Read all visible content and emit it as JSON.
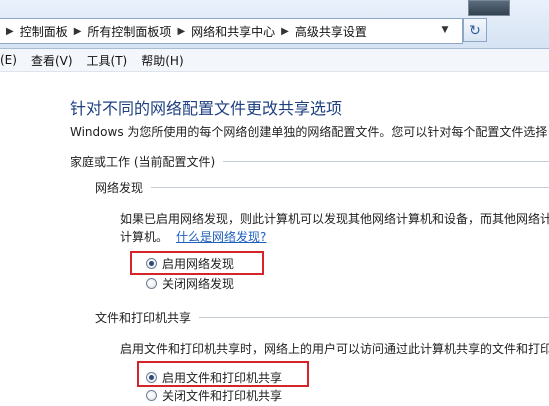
{
  "address_bar": {
    "crumbs": [
      "控制面板",
      "所有控制面板项",
      "网络和共享中心",
      "高级共享设置"
    ]
  },
  "menu": {
    "items": [
      "(E)",
      "查看(V)",
      "工具(T)",
      "帮助(H)"
    ]
  },
  "page": {
    "title": "针对不同的网络配置文件更改共享选项",
    "description": "Windows 为您所使用的每个网络创建单独的网络配置文件。您可以针对每个配置文件选择"
  },
  "profile": {
    "label": "家庭或工作 (当前配置文件)"
  },
  "network_discovery": {
    "label": "网络发现",
    "desc_line1": "如果已启用网络发现，则此计算机可以发现其他网络计算机和设备，而其他网络计",
    "desc_line2": "计算机。",
    "link": "什么是网络发现?",
    "option_on": "启用网络发现",
    "option_off": "关闭网络发现",
    "selected": "on"
  },
  "file_printer_sharing": {
    "label": "文件和打印机共享",
    "desc": "启用文件和打印机共享时，网络上的用户可以访问通过此计算机共享的文件和打印",
    "option_on": "启用文件和打印机共享",
    "option_off": "关闭文件和打印机共享",
    "selected": "on"
  },
  "colors": {
    "title": "#1e3f80",
    "link": "#1f5fbf",
    "highlight": "#d6242b"
  }
}
